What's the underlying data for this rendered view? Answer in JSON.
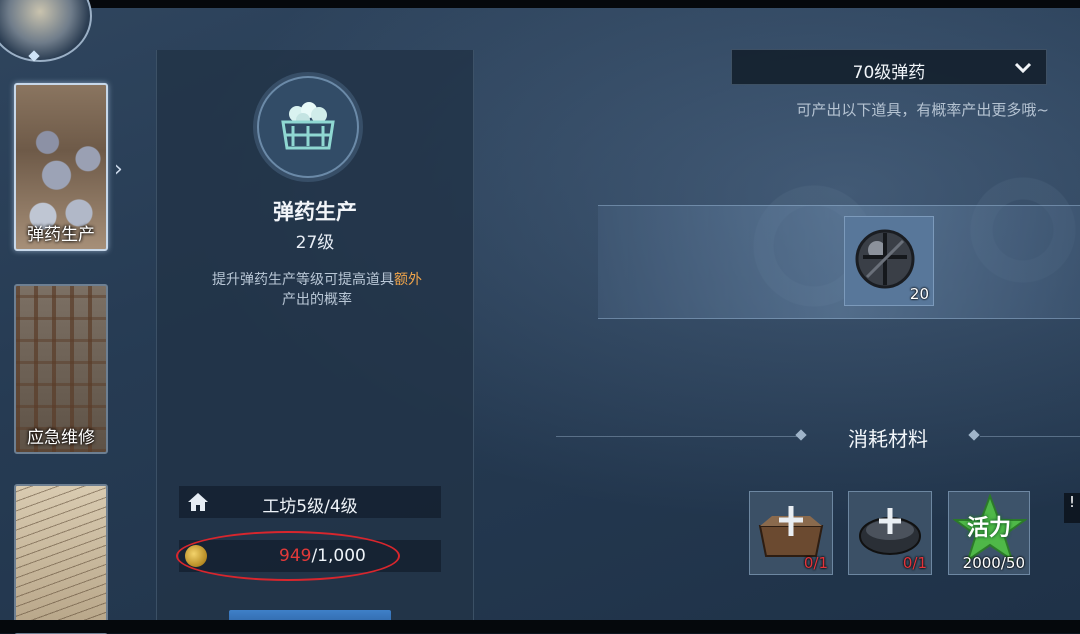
{
  "sidebar": {
    "items": [
      {
        "label": "弹药生产",
        "active": true
      },
      {
        "label": "应急维修",
        "active": false
      },
      {
        "label": "",
        "active": false
      }
    ]
  },
  "panel": {
    "title": "弹药生产",
    "level": "27级",
    "desc_before": "提升弹药生产等级可提高道具",
    "desc_highlight": "额外",
    "desc_after": "产出的概率",
    "workshop": "工坊5级/4级",
    "coin_current": "949",
    "coin_max": "/1,000"
  },
  "output": {
    "dropdown": "70级弹药",
    "hint": "可产出以下道具，有概率产出更多哦~",
    "item_count": "20"
  },
  "materials": {
    "title": "消耗材料",
    "items": [
      {
        "icon": "crate-icon",
        "count": "0",
        "need": "/1"
      },
      {
        "icon": "shell-casing-icon",
        "count": "0",
        "need": "/1"
      },
      {
        "icon": "vitality-icon",
        "label": "活力",
        "count": "2000",
        "need": "/50"
      }
    ]
  },
  "edge_badge": "!",
  "colors": {
    "highlight": "#f0a44a",
    "deficit": "#e23a3a",
    "annotation": "#d8262d"
  }
}
